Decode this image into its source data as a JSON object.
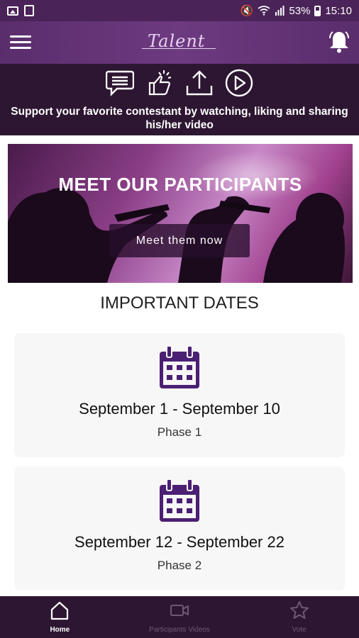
{
  "status_bar": {
    "battery": "53%",
    "time": "15:10",
    "left_icons": [
      "gallery-icon",
      "download-icon"
    ],
    "right_icons": [
      "mute-icon",
      "wifi-icon",
      "signal-icon",
      "battery-icon"
    ]
  },
  "header": {
    "logo_text": "Talent",
    "menu_icon": "hamburger-menu-icon",
    "notification_icon": "bell-icon"
  },
  "actions": {
    "icons": [
      "comment-icon",
      "like-icon",
      "share-icon",
      "play-icon"
    ],
    "support_text": "Support your favorite contestant by watching, liking and sharing his/her video"
  },
  "banner": {
    "title": "MEET OUR PARTICIPANTS",
    "button_label": "Meet them now"
  },
  "dates": {
    "heading": "IMPORTANT DATES",
    "items": [
      {
        "range": "September 1 - September 10",
        "phase": "Phase 1",
        "icon": "calendar-icon"
      },
      {
        "range": "September 12 - September 22",
        "phase": "Phase 2",
        "icon": "calendar-icon"
      }
    ]
  },
  "bottom_nav": {
    "items": [
      {
        "label": "Home",
        "icon": "home-icon",
        "active": true
      },
      {
        "label": "Participants Videos",
        "icon": "video-icon",
        "active": false
      },
      {
        "label": "Vote",
        "icon": "star-icon",
        "active": false
      }
    ]
  },
  "colors": {
    "primary_dark": "#2d1632",
    "header_purple": "#5a2d6c",
    "accent_purple": "#4b1f73",
    "card_background": "#f7f7f7"
  }
}
